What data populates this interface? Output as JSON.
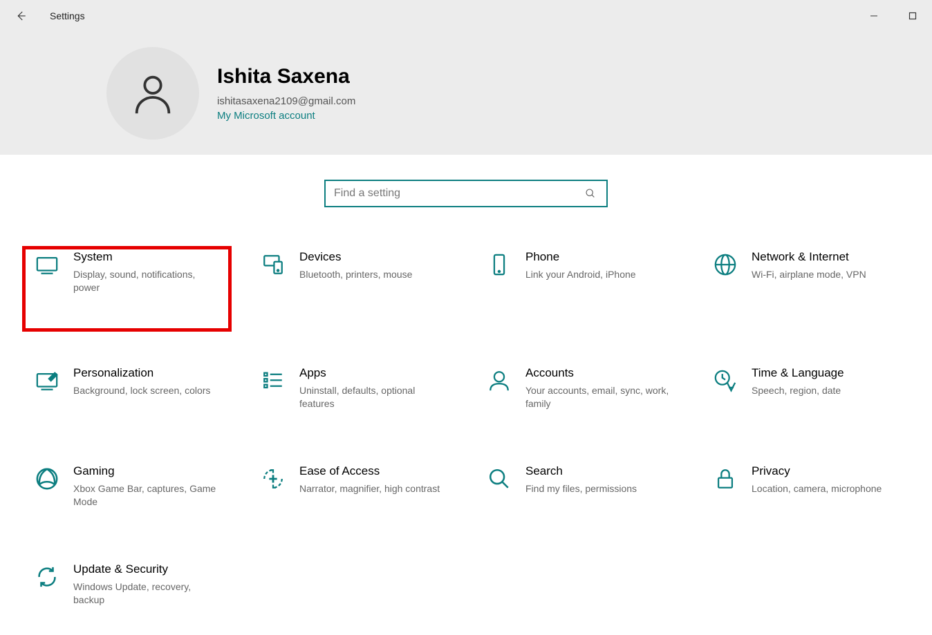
{
  "window": {
    "title": "Settings"
  },
  "account": {
    "name": "Ishita Saxena",
    "email": "ishitasaxena2109@gmail.com",
    "link": "My Microsoft account"
  },
  "search": {
    "placeholder": "Find a setting"
  },
  "tiles": {
    "system": {
      "title": "System",
      "desc": "Display, sound, notifications, power"
    },
    "devices": {
      "title": "Devices",
      "desc": "Bluetooth, printers, mouse"
    },
    "phone": {
      "title": "Phone",
      "desc": "Link your Android, iPhone"
    },
    "network": {
      "title": "Network & Internet",
      "desc": "Wi-Fi, airplane mode, VPN"
    },
    "personalization": {
      "title": "Personalization",
      "desc": "Background, lock screen, colors"
    },
    "apps": {
      "title": "Apps",
      "desc": "Uninstall, defaults, optional features"
    },
    "accounts": {
      "title": "Accounts",
      "desc": "Your accounts, email, sync, work, family"
    },
    "time": {
      "title": "Time & Language",
      "desc": "Speech, region, date"
    },
    "gaming": {
      "title": "Gaming",
      "desc": "Xbox Game Bar, captures, Game Mode"
    },
    "ease": {
      "title": "Ease of Access",
      "desc": "Narrator, magnifier, high contrast"
    },
    "search_tile": {
      "title": "Search",
      "desc": "Find my files, permissions"
    },
    "privacy": {
      "title": "Privacy",
      "desc": "Location, camera, microphone"
    },
    "update": {
      "title": "Update & Security",
      "desc": "Windows Update, recovery, backup"
    }
  },
  "colors": {
    "accent": "#0c7e80",
    "highlight": "#e60000"
  }
}
